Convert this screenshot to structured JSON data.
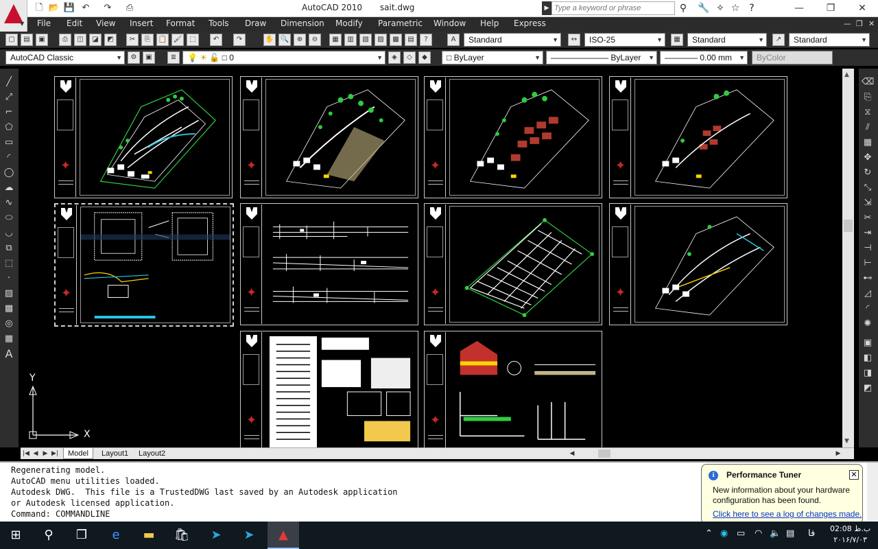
{
  "window": {
    "app_title": "AutoCAD 2010",
    "file_name": "sait.dwg",
    "search_placeholder": "Type a keyword or phrase",
    "minimize": "—",
    "restore": "❐",
    "close": "✕"
  },
  "menu": [
    "File",
    "Edit",
    "View",
    "Insert",
    "Format",
    "Tools",
    "Draw",
    "Dimension",
    "Modify",
    "Parametric",
    "Window",
    "Help",
    "Express"
  ],
  "toolbar1": {
    "text_style": "Standard",
    "dim_style": "ISO-25",
    "table_style": "Standard",
    "multileader_style": "Standard"
  },
  "toolbar2": {
    "workspace": "AutoCAD Classic",
    "layer": "0",
    "color": "ByLayer",
    "linetype": "ByLayer",
    "lineweight": "0.00 mm",
    "plot_style": "ByColor"
  },
  "ucs": {
    "y": "Y",
    "x": "X"
  },
  "tabs": [
    "Model",
    "Layout1",
    "Layout2"
  ],
  "command_lines": [
    "Regenerating model.",
    "AutoCAD menu utilities loaded.",
    "Autodesk DWG.  This file is a TrustedDWG last saved by an Autodesk application",
    "or Autodesk licensed application.",
    "Command: COMMANDLINE"
  ],
  "balloon": {
    "title": "Performance Tuner",
    "message": "New information about your hardware configuration has been found.",
    "link": "Click here to see a log of changes made."
  },
  "clock": {
    "time": "02:08 ب.ظ",
    "date": "۲۰۱۶/۷/۰۳"
  },
  "tray": {
    "language": "فا"
  },
  "colors": {
    "canvas": "#000000",
    "accent": "#c8102e",
    "menubar": "#2b2b2b",
    "link": "#0033cc"
  }
}
